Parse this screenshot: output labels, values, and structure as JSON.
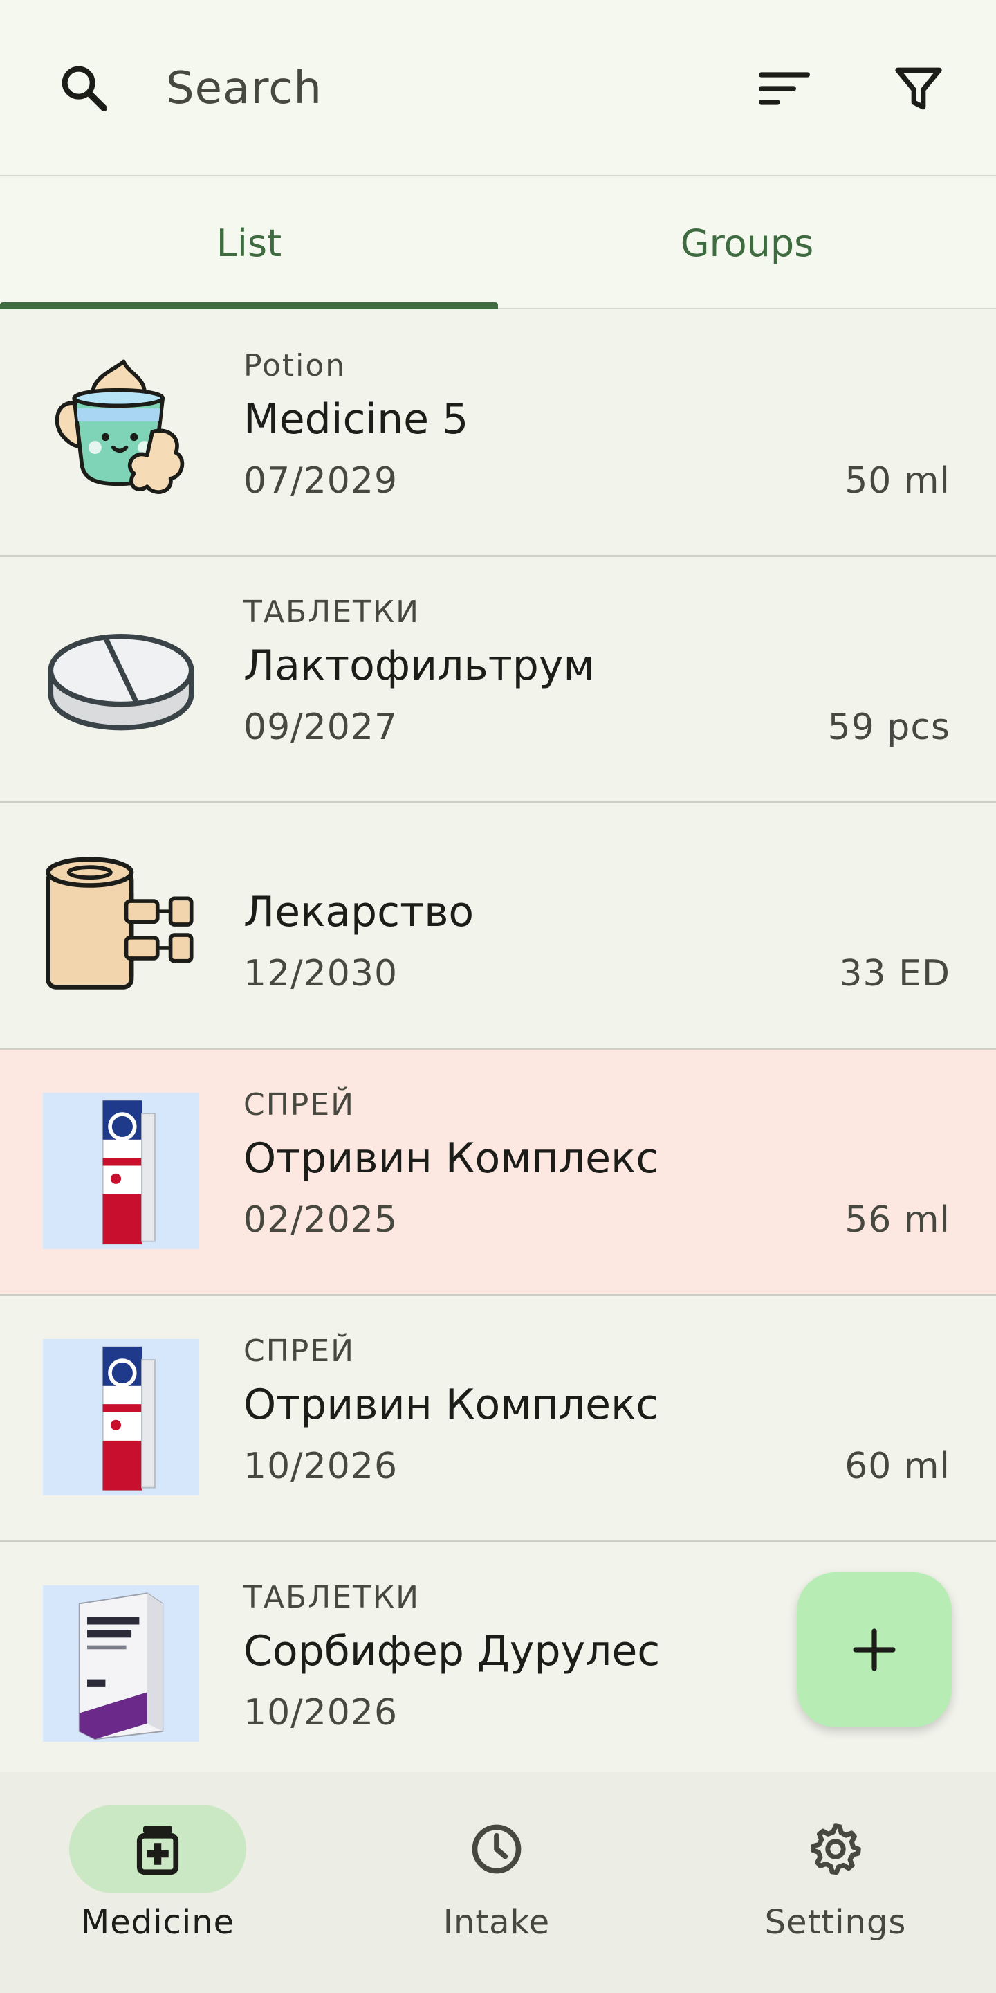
{
  "search": {
    "placeholder": "Search",
    "icon": "search-icon",
    "sort_icon": "sort-icon",
    "filter_icon": "filter-icon"
  },
  "tabs": [
    {
      "label": "List",
      "selected": true
    },
    {
      "label": "Groups",
      "selected": false
    }
  ],
  "colors": {
    "accent": "#3e6b3f",
    "expired_row": "#fde7e1",
    "fab": "#b7edb5",
    "nav_active_pill": "#cbe8c4"
  },
  "medicines": [
    {
      "form": "Potion",
      "name": "Medicine 5",
      "expiry": "07/2029",
      "amount": "50 ml",
      "icon": "potion-cup-icon",
      "expired": false
    },
    {
      "form": "ТАБЛЕТКИ",
      "name": "Лактофильтрум",
      "expiry": "09/2027",
      "amount": "59 pcs",
      "icon": "tablet-icon",
      "expired": false
    },
    {
      "form": "",
      "name": "Лекарство",
      "expiry": "12/2030",
      "amount": "33 ED",
      "icon": "bandage-icon",
      "expired": false
    },
    {
      "form": "СПРЕЙ",
      "name": "Отривин Комплекс",
      "expiry": "02/2025",
      "amount": "56 ml",
      "icon": "nasal-spray-photo",
      "expired": true
    },
    {
      "form": "СПРЕЙ",
      "name": "Отривин Комплекс",
      "expiry": "10/2026",
      "amount": "60 ml",
      "icon": "nasal-spray-photo",
      "expired": false
    },
    {
      "form": "ТАБЛЕТКИ",
      "name": "Сорбифер Дурулес",
      "expiry": "10/2026",
      "amount": "",
      "icon": "tablet-box-photo",
      "expired": false
    }
  ],
  "fab": {
    "icon": "plus-icon"
  },
  "bottom_nav": [
    {
      "label": "Medicine",
      "icon": "medicine-bottle-icon",
      "active": true
    },
    {
      "label": "Intake",
      "icon": "clock-icon",
      "active": false
    },
    {
      "label": "Settings",
      "icon": "gear-icon",
      "active": false
    }
  ]
}
